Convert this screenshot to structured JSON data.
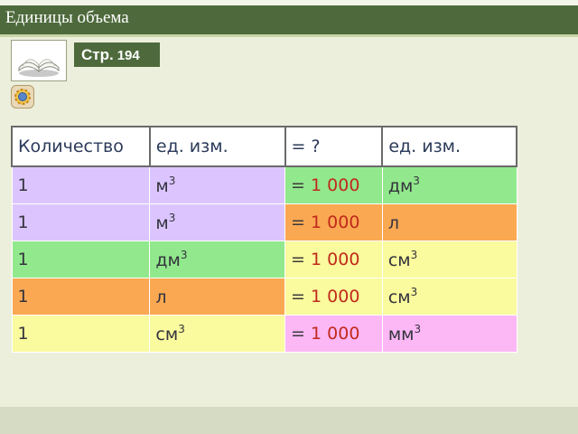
{
  "title": "Единицы объема",
  "page_badge": {
    "prefix": "Стр.",
    "number": "194"
  },
  "icons": {
    "book": "open-book-icon",
    "gear": "gear-icon"
  },
  "table": {
    "headers": [
      "Количество",
      "ед. изм.",
      "= ?",
      "ед. изм."
    ],
    "rows": [
      {
        "qty": "1",
        "from_unit": "м",
        "from_exp": "3",
        "eq": "=",
        "value": "1 000",
        "to_unit": "дм",
        "to_exp": "3"
      },
      {
        "qty": "1",
        "from_unit": "м",
        "from_exp": "3",
        "eq": "=",
        "value": "1 000",
        "to_unit": "л",
        "to_exp": ""
      },
      {
        "qty": "1",
        "from_unit": "дм",
        "from_exp": "3",
        "eq": "=",
        "value": "1 000",
        "to_unit": "см",
        "to_exp": "3"
      },
      {
        "qty": "1",
        "from_unit": "л",
        "from_exp": "",
        "eq": "=",
        "value": "1 000",
        "to_unit": "см",
        "to_exp": "3"
      },
      {
        "qty": "1",
        "from_unit": "см",
        "from_exp": "3",
        "eq": "=",
        "value": "1 000",
        "to_unit": "мм",
        "to_exp": "3"
      }
    ]
  },
  "colors": {
    "title_bar": "#4e6a3c",
    "violet": "#dcc5ff",
    "green": "#92e88c",
    "orange": "#fba853",
    "yellow": "#fafa9e",
    "pink": "#fcb7f5",
    "value_red": "#c02a1b"
  }
}
